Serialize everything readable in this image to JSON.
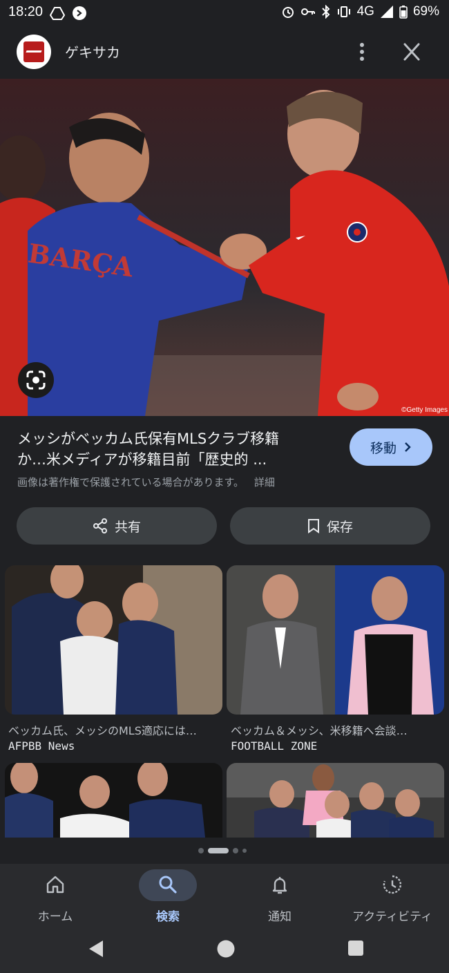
{
  "status": {
    "time": "18:20",
    "network": "4G",
    "battery": "69%"
  },
  "appbar": {
    "title": "ゲキサカ"
  },
  "hero": {
    "credit": "©Getty Images",
    "jacket_text": "BARÇA"
  },
  "result": {
    "title_line1": "メッシがベッカム氏保有MLSクラブ移籍",
    "title_line2": "か…米メディアが移籍目前「歴史的 ...",
    "visit_label": "移動",
    "copyright": "画像は著作権で保護されている場合があります。",
    "details_label": "詳細"
  },
  "actions": {
    "share_label": "共有",
    "save_label": "保存"
  },
  "related": [
    {
      "caption": "ベッカム氏、メッシのMLS適応には…",
      "source": "AFPBB News"
    },
    {
      "caption": "ベッカム＆メッシ、米移籍へ会談…",
      "source": "FOOTBALL ZONE"
    }
  ],
  "bottom_nav": [
    {
      "label": "ホーム",
      "icon": "home-icon"
    },
    {
      "label": "検索",
      "icon": "search-icon",
      "active": true
    },
    {
      "label": "通知",
      "icon": "bell-icon"
    },
    {
      "label": "アクティビティ",
      "icon": "activity-icon"
    }
  ],
  "colors": {
    "background": "#202124",
    "accent": "#a8c7fa",
    "chip": "#3c4043"
  }
}
